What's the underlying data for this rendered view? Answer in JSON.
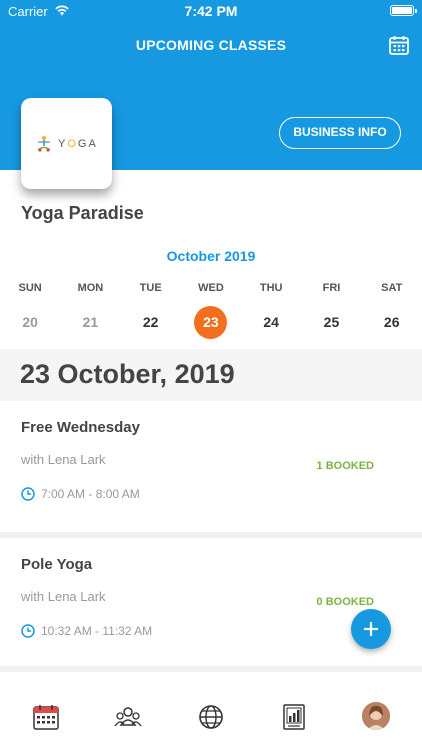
{
  "status_bar": {
    "carrier": "Carrier",
    "time": "7:42 PM"
  },
  "header": {
    "title": "UPCOMING CLASSES",
    "business_info_label": "BUSINESS INFO"
  },
  "business": {
    "name": "Yoga Paradise",
    "logo_text_prefix": "Y",
    "logo_text_o": "O",
    "logo_text_suffix": "GA"
  },
  "calendar": {
    "month_label": "October 2019",
    "day_names": [
      "SUN",
      "MON",
      "TUE",
      "WED",
      "THU",
      "FRI",
      "SAT"
    ],
    "day_numbers": [
      "20",
      "21",
      "22",
      "23",
      "24",
      "25",
      "26"
    ],
    "selected_index": 3
  },
  "selected_date": "23 October, 2019",
  "classes": [
    {
      "name": "Free Wednesday",
      "teacher": "with Lena Lark",
      "time": "7:00 AM - 8:00 AM",
      "booked": "1 BOOKED"
    },
    {
      "name": "Pole Yoga",
      "teacher": "with Lena Lark",
      "time": "10:32 AM - 11:32 AM",
      "booked": "0 BOOKED"
    }
  ],
  "colors": {
    "primary": "#1699e1",
    "accent": "#f36f20",
    "booked": "#7cb342"
  },
  "icons": {
    "header_right": "calendar-icon",
    "fab": "plus-icon",
    "tabs": [
      "calendar-icon",
      "group-icon",
      "globe-icon",
      "report-icon",
      "avatar"
    ]
  }
}
